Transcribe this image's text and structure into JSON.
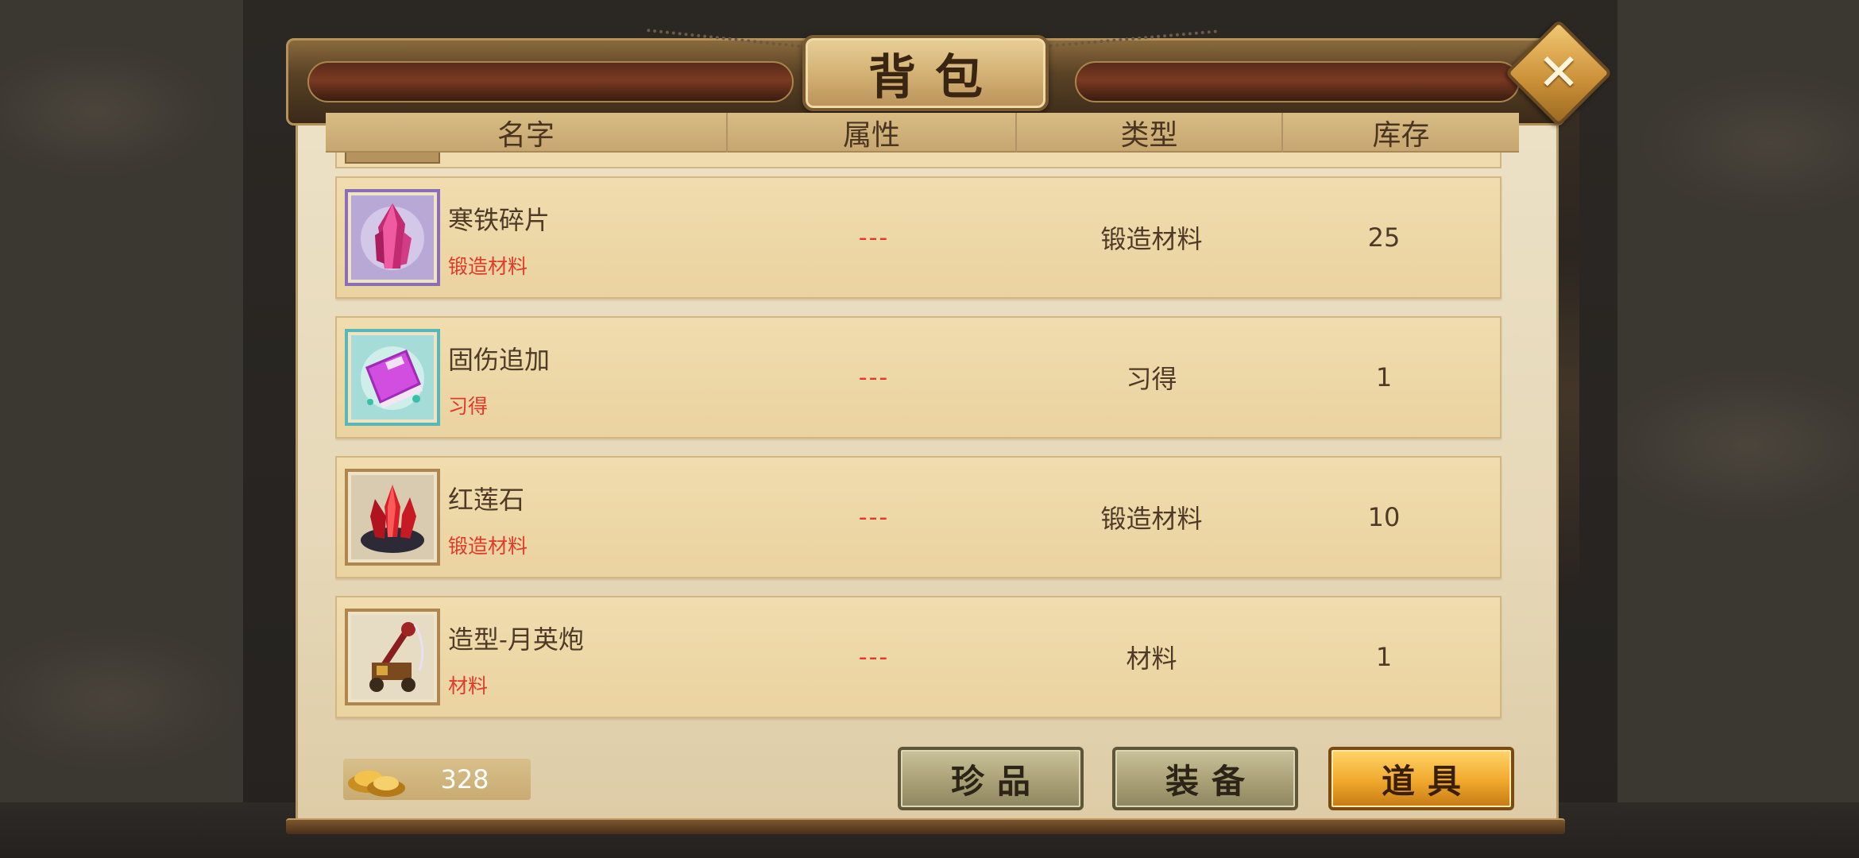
{
  "window": {
    "title": "背包"
  },
  "columns": [
    "名字",
    "属性",
    "类型",
    "库存"
  ],
  "items": [
    {
      "name": "寒铁碎片",
      "subtype": "锻造材料",
      "attribute": "---",
      "type": "锻造材料",
      "stock": "25",
      "icon": "crystal-shard-icon"
    },
    {
      "name": "固伤追加",
      "subtype": "习得",
      "attribute": "---",
      "type": "习得",
      "stock": "1",
      "icon": "skill-book-icon"
    },
    {
      "name": "红莲石",
      "subtype": "锻造材料",
      "attribute": "---",
      "type": "锻造材料",
      "stock": "10",
      "icon": "red-crystal-icon"
    },
    {
      "name": "造型-月英炮",
      "subtype": "材料",
      "attribute": "---",
      "type": "材料",
      "stock": "1",
      "icon": "catapult-icon"
    }
  ],
  "footer": {
    "gold_icon": "gold-ingot-icon",
    "gold_amount": "328",
    "tabs": [
      {
        "label": "珍品",
        "active": false
      },
      {
        "label": "装备",
        "active": false
      },
      {
        "label": "道具",
        "active": true
      }
    ]
  },
  "colors": {
    "subtype_red": "#e23a2a",
    "active_tab": "#f0a82c",
    "parchment": "#ece1c6"
  }
}
